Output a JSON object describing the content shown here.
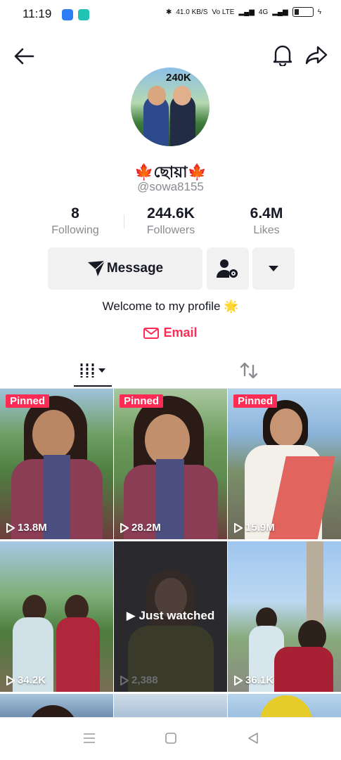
{
  "status_bar": {
    "time": "11:19",
    "net_speed": "41.0 KB/S",
    "network": "4G",
    "volte": "Vo LTE"
  },
  "header": {
    "back_icon": "arrow-left-icon",
    "bell_icon": "bell-icon",
    "share_icon": "share-icon"
  },
  "profile": {
    "avatar_badge": "240K",
    "display_name": "🍁ছোয়া🍁",
    "handle": "@sowa8155",
    "bio": "Welcome to my profile 🌟"
  },
  "stats": [
    {
      "value": "8",
      "label": "Following"
    },
    {
      "value": "244.6K",
      "label": "Followers"
    },
    {
      "value": "6.4M",
      "label": "Likes"
    }
  ],
  "actions": {
    "message_label": "Message",
    "email_label": "Email"
  },
  "tabs": {
    "videos_icon": "videos-grid-icon",
    "reposts_icon": "repost-icon"
  },
  "videos": [
    {
      "badge": "Pinned",
      "views": "13.8M"
    },
    {
      "badge": "Pinned",
      "views": "28.2M"
    },
    {
      "badge": "Pinned",
      "views": "15.9M"
    },
    {
      "badge": "",
      "views": "34.2K"
    },
    {
      "badge": "",
      "views": "2,388",
      "overlay": "Just watched"
    },
    {
      "badge": "",
      "views": "36.1K"
    }
  ],
  "colors": {
    "accent": "#fe2c55",
    "button_bg": "#f1f1f2",
    "muted_text": "#8a8b91"
  }
}
